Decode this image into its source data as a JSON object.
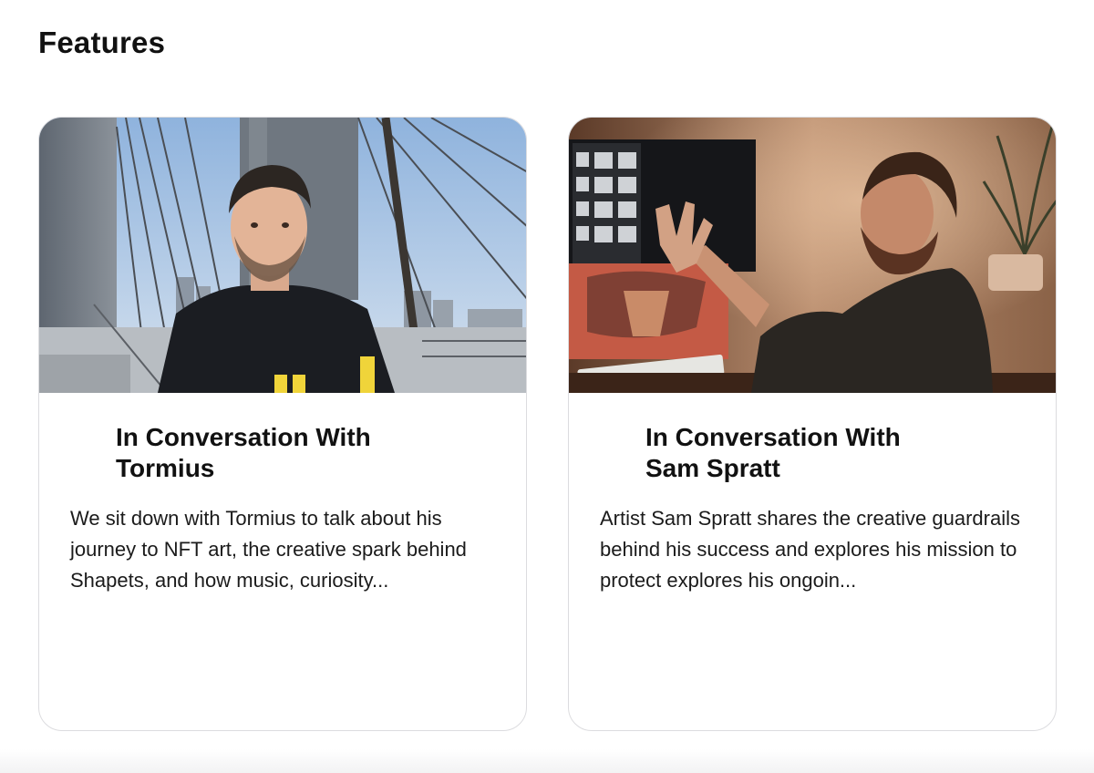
{
  "section": {
    "title": "Features"
  },
  "cards": [
    {
      "title": "In Conversation With Tormius",
      "description": "We sit down with Tormius to talk about his journey to NFT art, the creative spark behind Shapets, and how music, curiosity...",
      "image": "photo-man-on-bridge"
    },
    {
      "title": "In Conversation With Sam Spratt",
      "description": "Artist Sam Spratt shares the creative guardrails behind his success and explores his mission to protect explores his ongoin...",
      "image": "photo-artist-at-desk"
    }
  ]
}
